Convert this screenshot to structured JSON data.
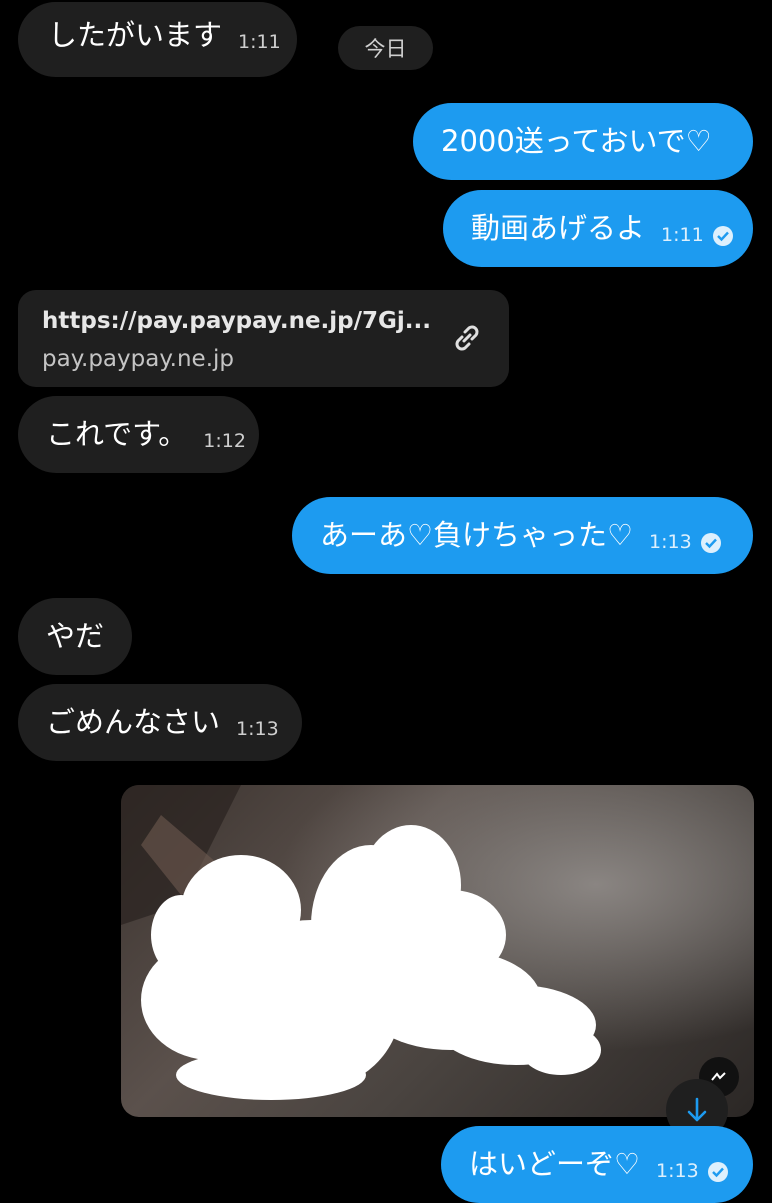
{
  "day_separator": "今日",
  "messages": {
    "m1": {
      "text": "したがいます",
      "time": "1:11"
    },
    "m2": {
      "text": "2000送っておいで♡"
    },
    "m3": {
      "text": "動画あげるよ",
      "time": "1:11"
    },
    "link": {
      "url": "https://pay.paypay.ne.jp/7Gj...",
      "domain": "pay.paypay.ne.jp"
    },
    "m4": {
      "text": "これです。",
      "time": "1:12"
    },
    "m5": {
      "text": "あーあ♡負けちゃった♡",
      "time": "1:13"
    },
    "m6": {
      "text": "やだ"
    },
    "m7": {
      "text": "ごめんなさい",
      "time": "1:13"
    },
    "m8": {
      "text": "はいどーぞ♡",
      "time": "1:13"
    }
  },
  "icons": {
    "link": "link-icon",
    "read": "check-circle-icon",
    "scroll": "arrow-down-icon",
    "media_badge": "gif-badge-icon"
  },
  "colors": {
    "background": "#000000",
    "incoming_bubble": "#1f1f1f",
    "outgoing_bubble": "#1d9bf0",
    "accent": "#1d9bf0"
  }
}
